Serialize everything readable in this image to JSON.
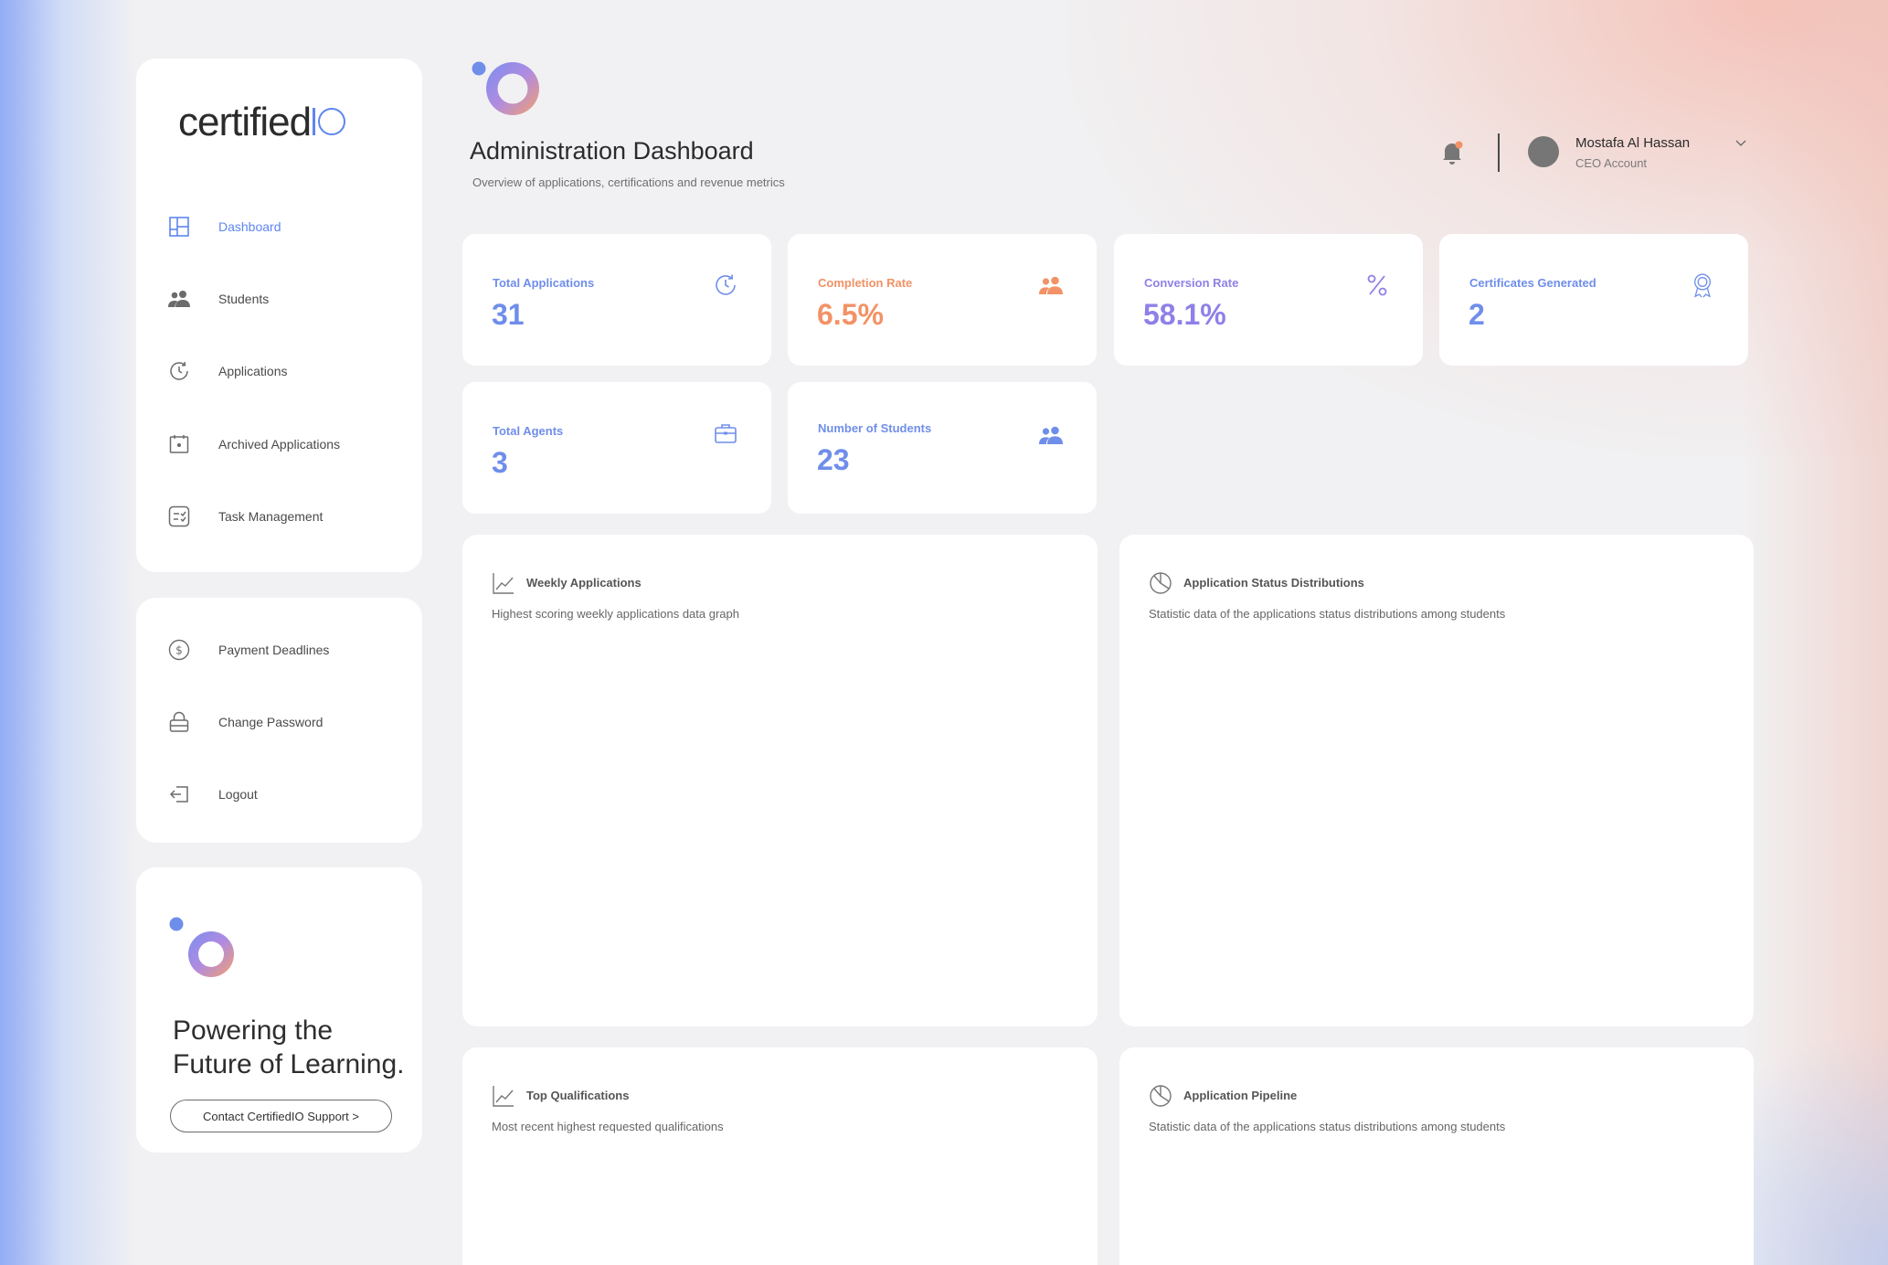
{
  "brand": {
    "logo_main": "certified",
    "logo_io": "IO"
  },
  "sidebar": {
    "items": [
      {
        "label": "Dashboard",
        "icon": "dashboard-grid-icon",
        "active": true
      },
      {
        "label": "Students",
        "icon": "users-icon",
        "active": false
      },
      {
        "label": "Applications",
        "icon": "clock-refresh-icon",
        "active": false
      },
      {
        "label": "Archived Applications",
        "icon": "archive-box-icon",
        "active": false
      },
      {
        "label": "Task Management",
        "icon": "task-list-icon",
        "active": false
      }
    ],
    "secondary": [
      {
        "label": "Payment Deadlines",
        "icon": "dollar-circle-icon"
      },
      {
        "label": "Change Password",
        "icon": "lock-icon"
      },
      {
        "label": "Logout",
        "icon": "logout-icon"
      }
    ],
    "promo": {
      "title_line1": "Powering the",
      "title_line2": "Future of Learning.",
      "button": "Contact CertifiedIO Support  >"
    }
  },
  "header": {
    "title": "Administration Dashboard",
    "subtitle": "Overview of applications, certifications and revenue metrics",
    "user": {
      "name": "Mostafa Al Hassan",
      "role": "CEO Account"
    }
  },
  "stats": [
    {
      "label": "Total Applications",
      "value": "31",
      "color": "#6f8eea",
      "icon": "clock-refresh-icon"
    },
    {
      "label": "Completion Rate",
      "value": "6.5%",
      "color": "#f29266",
      "icon": "users-icon"
    },
    {
      "label": "Conversion Rate",
      "value": "58.1%",
      "color": "#8e80e8",
      "icon": "percent-icon"
    },
    {
      "label": "Certificates Generated",
      "value": "2",
      "color": "#6f8eea",
      "icon": "award-ribbon-icon"
    },
    {
      "label": "Total Agents",
      "value": "3",
      "color": "#6f8eea",
      "icon": "briefcase-icon"
    },
    {
      "label": "Number of Students",
      "value": "23",
      "color": "#6f8eea",
      "icon": "users-icon"
    }
  ],
  "panels": [
    {
      "title": "Weekly Applications",
      "subtitle": "Highest scoring weekly applications data graph",
      "icon": "line-chart-icon"
    },
    {
      "title": "Application Status Distributions",
      "subtitle": "Statistic data of the applications status distributions among students",
      "icon": "pie-chart-icon"
    },
    {
      "title": "Top Qualifications",
      "subtitle": "Most recent highest requested qualifications",
      "icon": "line-chart-icon"
    },
    {
      "title": "Application Pipeline",
      "subtitle": "Statistic data of the applications status distributions among students",
      "icon": "pie-chart-icon"
    }
  ],
  "colors": {
    "accent_blue": "#5e86f0",
    "accent_orange": "#f29266",
    "accent_purple": "#8e80e8",
    "notification_dot": "#f29266"
  }
}
